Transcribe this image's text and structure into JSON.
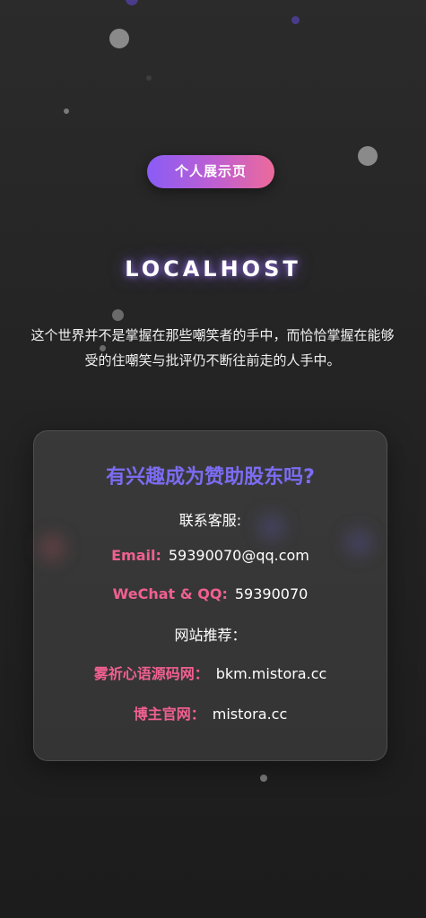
{
  "badge": {
    "label": "个人展示页"
  },
  "brand": {
    "title": "LOCALHOST"
  },
  "quote": {
    "text": "这个世界并不是掌握在那些嘲笑者的手中，而恰恰掌握在能够受的住嘲笑与批评仍不断往前走的人手中。"
  },
  "card": {
    "title": "有兴趣成为赞助股东吗?",
    "contact_heading": "联系客服:",
    "email_label": "Email:",
    "email_value": "59390070@qq.com",
    "wechat_label": "WeChat & QQ:",
    "wechat_value": "59390070",
    "sites_heading": "网站推荐：",
    "site1_label": "雾祈心语源码网：",
    "site1_value": "bkm.mistora.cc",
    "site2_label": "博主官网：",
    "site2_value": "mistora.cc"
  },
  "colors": {
    "accent_title": "#7b6cf2",
    "accent_label": "#f06090",
    "badge_gradient_start": "#8a5cf6",
    "badge_gradient_end": "#ec6a9a"
  }
}
